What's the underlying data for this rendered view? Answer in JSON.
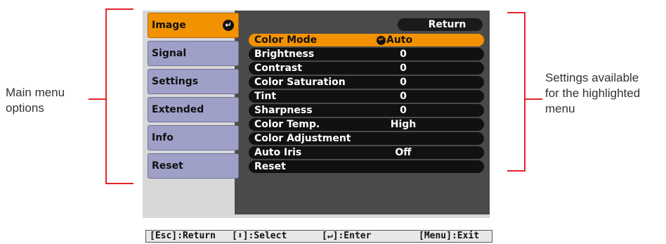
{
  "annotations": {
    "left": [
      "Main menu",
      "options"
    ],
    "right": [
      "Settings available",
      "for the highlighted",
      "menu"
    ]
  },
  "main_menu": [
    {
      "label": "Image",
      "active": true
    },
    {
      "label": "Signal",
      "active": false
    },
    {
      "label": "Settings",
      "active": false
    },
    {
      "label": "Extended",
      "active": false
    },
    {
      "label": "Info",
      "active": false
    },
    {
      "label": "Reset",
      "active": false
    }
  ],
  "return_button": "Return",
  "settings": [
    {
      "label": "Color Mode",
      "value": "Auto",
      "active": true
    },
    {
      "label": "Brightness",
      "value": "0"
    },
    {
      "label": "Contrast",
      "value": "0"
    },
    {
      "label": "Color Saturation",
      "value": "0"
    },
    {
      "label": "Tint",
      "value": "0"
    },
    {
      "label": "Sharpness",
      "value": "0"
    },
    {
      "label": "Color Temp.",
      "value": "High"
    },
    {
      "label": "Color Adjustment",
      "value": ""
    },
    {
      "label": "Auto Iris",
      "value": "Off"
    },
    {
      "label": "Reset",
      "value": ""
    }
  ],
  "footer": {
    "return": "[Esc]:Return",
    "select": "[⬍]:Select",
    "enter": "[↵]:Enter",
    "exit": "[Menu]:Exit"
  },
  "colors": {
    "highlight": "#f39200",
    "menu_item": "#9ea0c8",
    "panel": "#4a4a4a",
    "bracket": "#e3242b"
  }
}
